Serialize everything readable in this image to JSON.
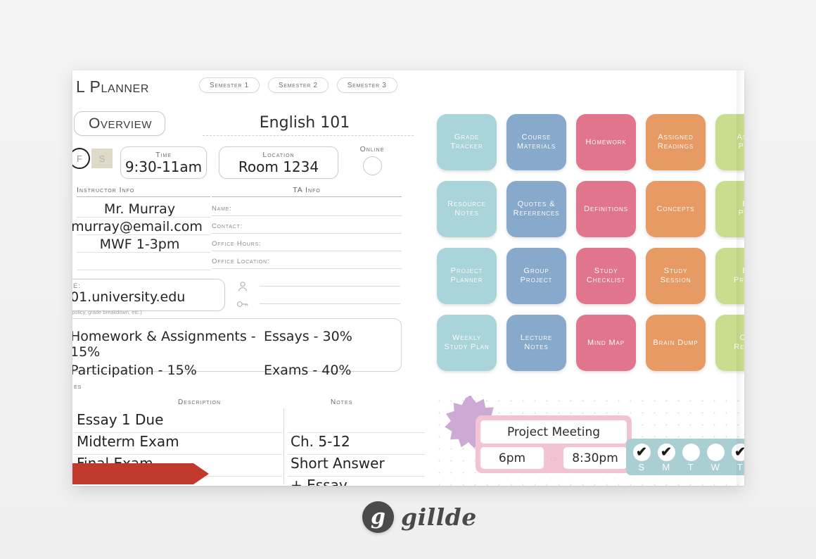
{
  "header": {
    "app_title": "L Planner",
    "semester_tabs": [
      "Semester 1",
      "Semester 2",
      "Semester 3"
    ],
    "icons": [
      "person-icon",
      "graduation-cap-icon",
      "money-bag-icon",
      "target-icon",
      "crown-icon",
      "brain-icon"
    ]
  },
  "sheet": {
    "overview_pill": "Overview",
    "course_title": "English 101",
    "days": {
      "circled": "F",
      "boxed": "S"
    },
    "time": {
      "label": "Time",
      "value": "9:30-11am"
    },
    "location": {
      "label": "Location",
      "value": "Room 1234"
    },
    "online": {
      "label": "Online"
    },
    "instructor": {
      "heading": "Instructor Info",
      "lines": [
        "Mr. Murray",
        "murray@email.com",
        "MWF 1-3pm"
      ]
    },
    "ta": {
      "heading": "TA Info",
      "rows": [
        "Name:",
        "Contact:",
        "Office Hours:",
        "Office Location:"
      ]
    },
    "website": {
      "label": "E:",
      "value": "01.university.edu"
    },
    "grading": {
      "hint": "e policy, grade breakdown, etc.)",
      "items": [
        "Homework & Assignments - 15%",
        "Essays - 30%",
        "Participation - 15%",
        "Exams - 40%"
      ]
    },
    "dates": {
      "section_label": "es",
      "columns": [
        "Description",
        "Notes"
      ],
      "descriptions": [
        "Essay 1 Due",
        "Midterm Exam",
        "Final Exam"
      ],
      "notes": [
        "",
        "Ch. 5-12",
        "Short Answer",
        "+ Essay"
      ]
    }
  },
  "tiles": [
    {
      "label_1": "Grade",
      "label_2": "Tracker",
      "color": "#a9d4d9"
    },
    {
      "label_1": "Course",
      "label_2": "Materials",
      "color": "#87a9cc"
    },
    {
      "label_1": "Homework",
      "label_2": "",
      "color": "#e0758c"
    },
    {
      "label_1": "Assigned",
      "label_2": "Readings",
      "color": "#e79a63"
    },
    {
      "label_1": "Assi",
      "label_2": "Pla",
      "color": "#c9dd8e"
    },
    {
      "label_1": "Resource",
      "label_2": "Notes",
      "color": "#a9d4d9"
    },
    {
      "label_1": "Quotes &",
      "label_2": "References",
      "color": "#87a9cc"
    },
    {
      "label_1": "Definitions",
      "label_2": "",
      "color": "#e0758c"
    },
    {
      "label_1": "Concepts",
      "label_2": "",
      "color": "#e79a63"
    },
    {
      "label_1": "E",
      "label_2": "Pla",
      "color": "#c9dd8e"
    },
    {
      "label_1": "Project",
      "label_2": "Planner",
      "color": "#a9d4d9"
    },
    {
      "label_1": "Group",
      "label_2": "Project",
      "color": "#87a9cc"
    },
    {
      "label_1": "Study",
      "label_2": "Checklist",
      "color": "#e0758c"
    },
    {
      "label_1": "Study",
      "label_2": "Session",
      "color": "#e79a63"
    },
    {
      "label_1": "E",
      "label_2": "Prepa",
      "color": "#c9dd8e"
    },
    {
      "label_1": "Weekly",
      "label_2": "Study Plan",
      "color": "#a9d4d9"
    },
    {
      "label_1": "Lecture",
      "label_2": "Notes",
      "color": "#87a9cc"
    },
    {
      "label_1": "Mind Map",
      "label_2": "",
      "color": "#e0758c"
    },
    {
      "label_1": "Brain Dump",
      "label_2": "",
      "color": "#e79a63"
    },
    {
      "label_1": "Co",
      "label_2": "Refle",
      "color": "#c9dd8e"
    }
  ],
  "memo": {
    "meeting_title": "Project Meeting",
    "start_time": "6pm",
    "to_label": "to",
    "end_time": "8:30pm",
    "days": [
      {
        "letter": "S",
        "checked": true
      },
      {
        "letter": "M",
        "checked": true
      },
      {
        "letter": "T",
        "checked": false
      },
      {
        "letter": "W",
        "checked": false
      },
      {
        "letter": "T",
        "checked": true
      }
    ]
  },
  "footer": {
    "logo_mark": "g",
    "logo_word": "gillde"
  },
  "colors": {
    "page_bg": "#f2f2f2",
    "teal": "#a9d4d9",
    "blue": "#87a9cc",
    "pink": "#e0758c",
    "orange": "#e79a63",
    "green": "#c9dd8e",
    "ribbon_red": "#c0392b",
    "burst_purple": "#ccaad4",
    "meeting_pink": "#f2c4d3",
    "daystrip_teal": "#a9cfd2"
  }
}
